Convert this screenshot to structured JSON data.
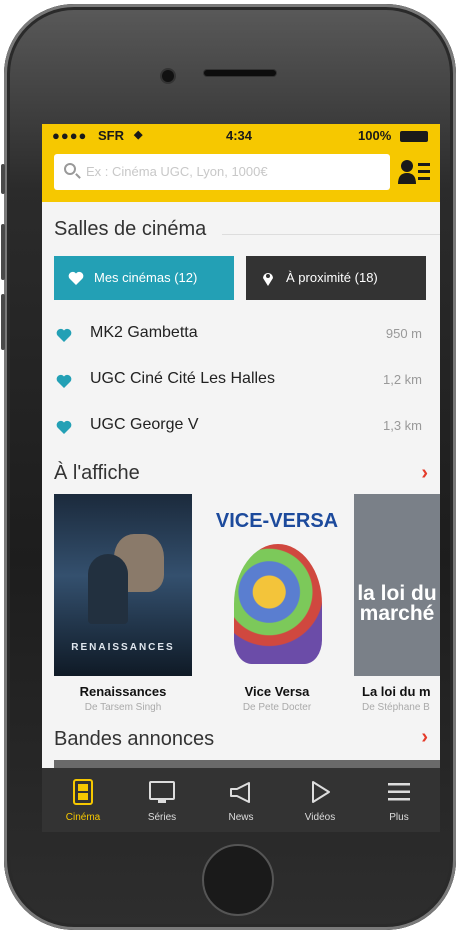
{
  "status_bar": {
    "carrier": "SFR",
    "time": "4:34",
    "battery": "100%"
  },
  "search": {
    "placeholder": "Ex : Cinéma UGC, Lyon, 1000€"
  },
  "cinemas_section": {
    "title": "Salles de cinéma",
    "tab_mine": "Mes cinémas (12)",
    "tab_nearby": "À proximité (18)",
    "items": [
      {
        "name": "MK2 Gambetta",
        "distance": "950 m"
      },
      {
        "name": "UGC Ciné Cité Les Halles",
        "distance": "1,2 km"
      },
      {
        "name": "UGC George V",
        "distance": "1,3 km"
      }
    ]
  },
  "affiche": {
    "title": "À l'affiche",
    "movies": [
      {
        "title": "Renaissances",
        "director": "De Tarsem Singh",
        "poster_text": "RENAISSANCES"
      },
      {
        "title": "Vice Versa",
        "director": "De Pete Docter",
        "poster_text": "VICE-VERSA"
      },
      {
        "title": "La loi du m",
        "director": "De Stéphane B",
        "poster_text": "la loi du marché"
      }
    ]
  },
  "trailers": {
    "title": "Bandes annonces"
  },
  "tabbar": {
    "items": [
      {
        "label": "Cinéma",
        "icon": "film-icon"
      },
      {
        "label": "Séries",
        "icon": "tv-icon"
      },
      {
        "label": "News",
        "icon": "megaphone-icon"
      },
      {
        "label": "Vidéos",
        "icon": "play-icon"
      },
      {
        "label": "Plus",
        "icon": "menu-icon"
      }
    ]
  },
  "colors": {
    "brand_yellow": "#f6c800",
    "teal": "#23a0b5",
    "dark": "#333333",
    "chevron_red": "#e53b2a"
  }
}
